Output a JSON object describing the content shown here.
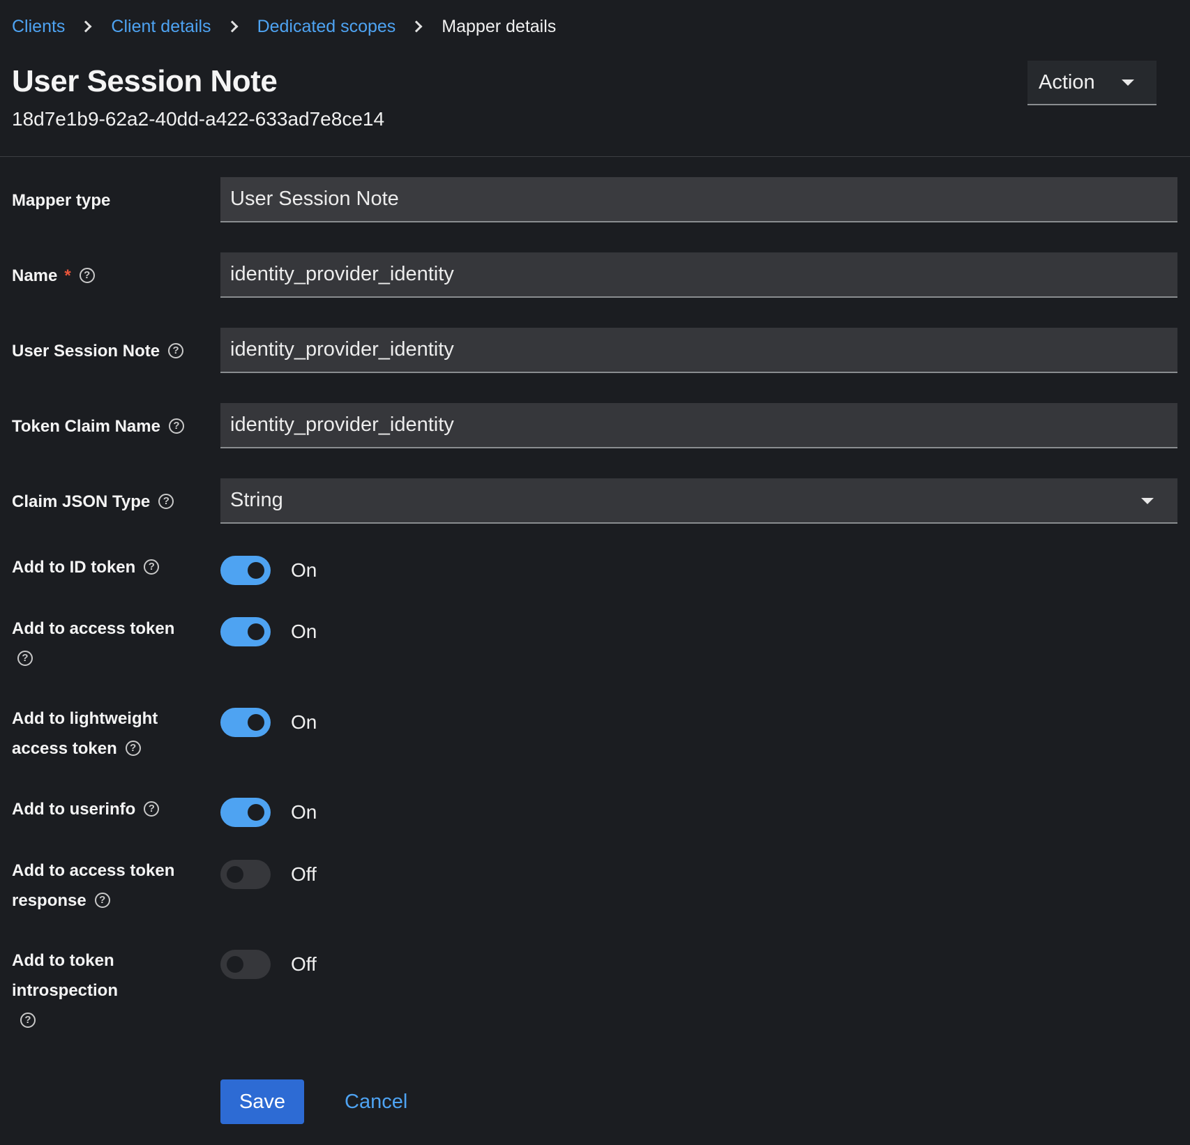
{
  "breadcrumb": {
    "items": [
      "Clients",
      "Client details",
      "Dedicated scopes"
    ],
    "current": "Mapper details"
  },
  "header": {
    "title": "User Session Note",
    "id": "18d7e1b9-62a2-40dd-a422-633ad7e8ce14",
    "action_label": "Action"
  },
  "form": {
    "mapper_type": {
      "label": "Mapper type",
      "value": "User Session Note"
    },
    "name": {
      "label": "Name",
      "required_mark": "*",
      "value": "identity_provider_identity"
    },
    "user_session_note": {
      "label": "User Session Note",
      "value": "identity_provider_identity"
    },
    "token_claim_name": {
      "label": "Token Claim Name",
      "value": "identity_provider_identity"
    },
    "claim_json_type": {
      "label": "Claim JSON Type",
      "value": "String"
    },
    "toggles": [
      {
        "label": "Add to ID token",
        "state": "On",
        "on": true
      },
      {
        "label": "Add to access token",
        "state": "On",
        "on": true
      },
      {
        "label": "Add to lightweight access token",
        "state": "On",
        "on": true
      },
      {
        "label": "Add to userinfo",
        "state": "On",
        "on": true
      },
      {
        "label": "Add to access token response",
        "state": "Off",
        "on": false
      },
      {
        "label": "Add to token introspection",
        "state": "Off",
        "on": false
      }
    ]
  },
  "footer": {
    "save_label": "Save",
    "cancel_label": "Cancel"
  },
  "icons": {
    "help": "help-icon",
    "dropdown": "caret-down-icon",
    "separator": "chevron-right-icon"
  },
  "colors": {
    "accent": "#4ea3f2",
    "primary_button": "#2d6bd4",
    "background": "#1b1d21",
    "required": "#e8553a"
  }
}
